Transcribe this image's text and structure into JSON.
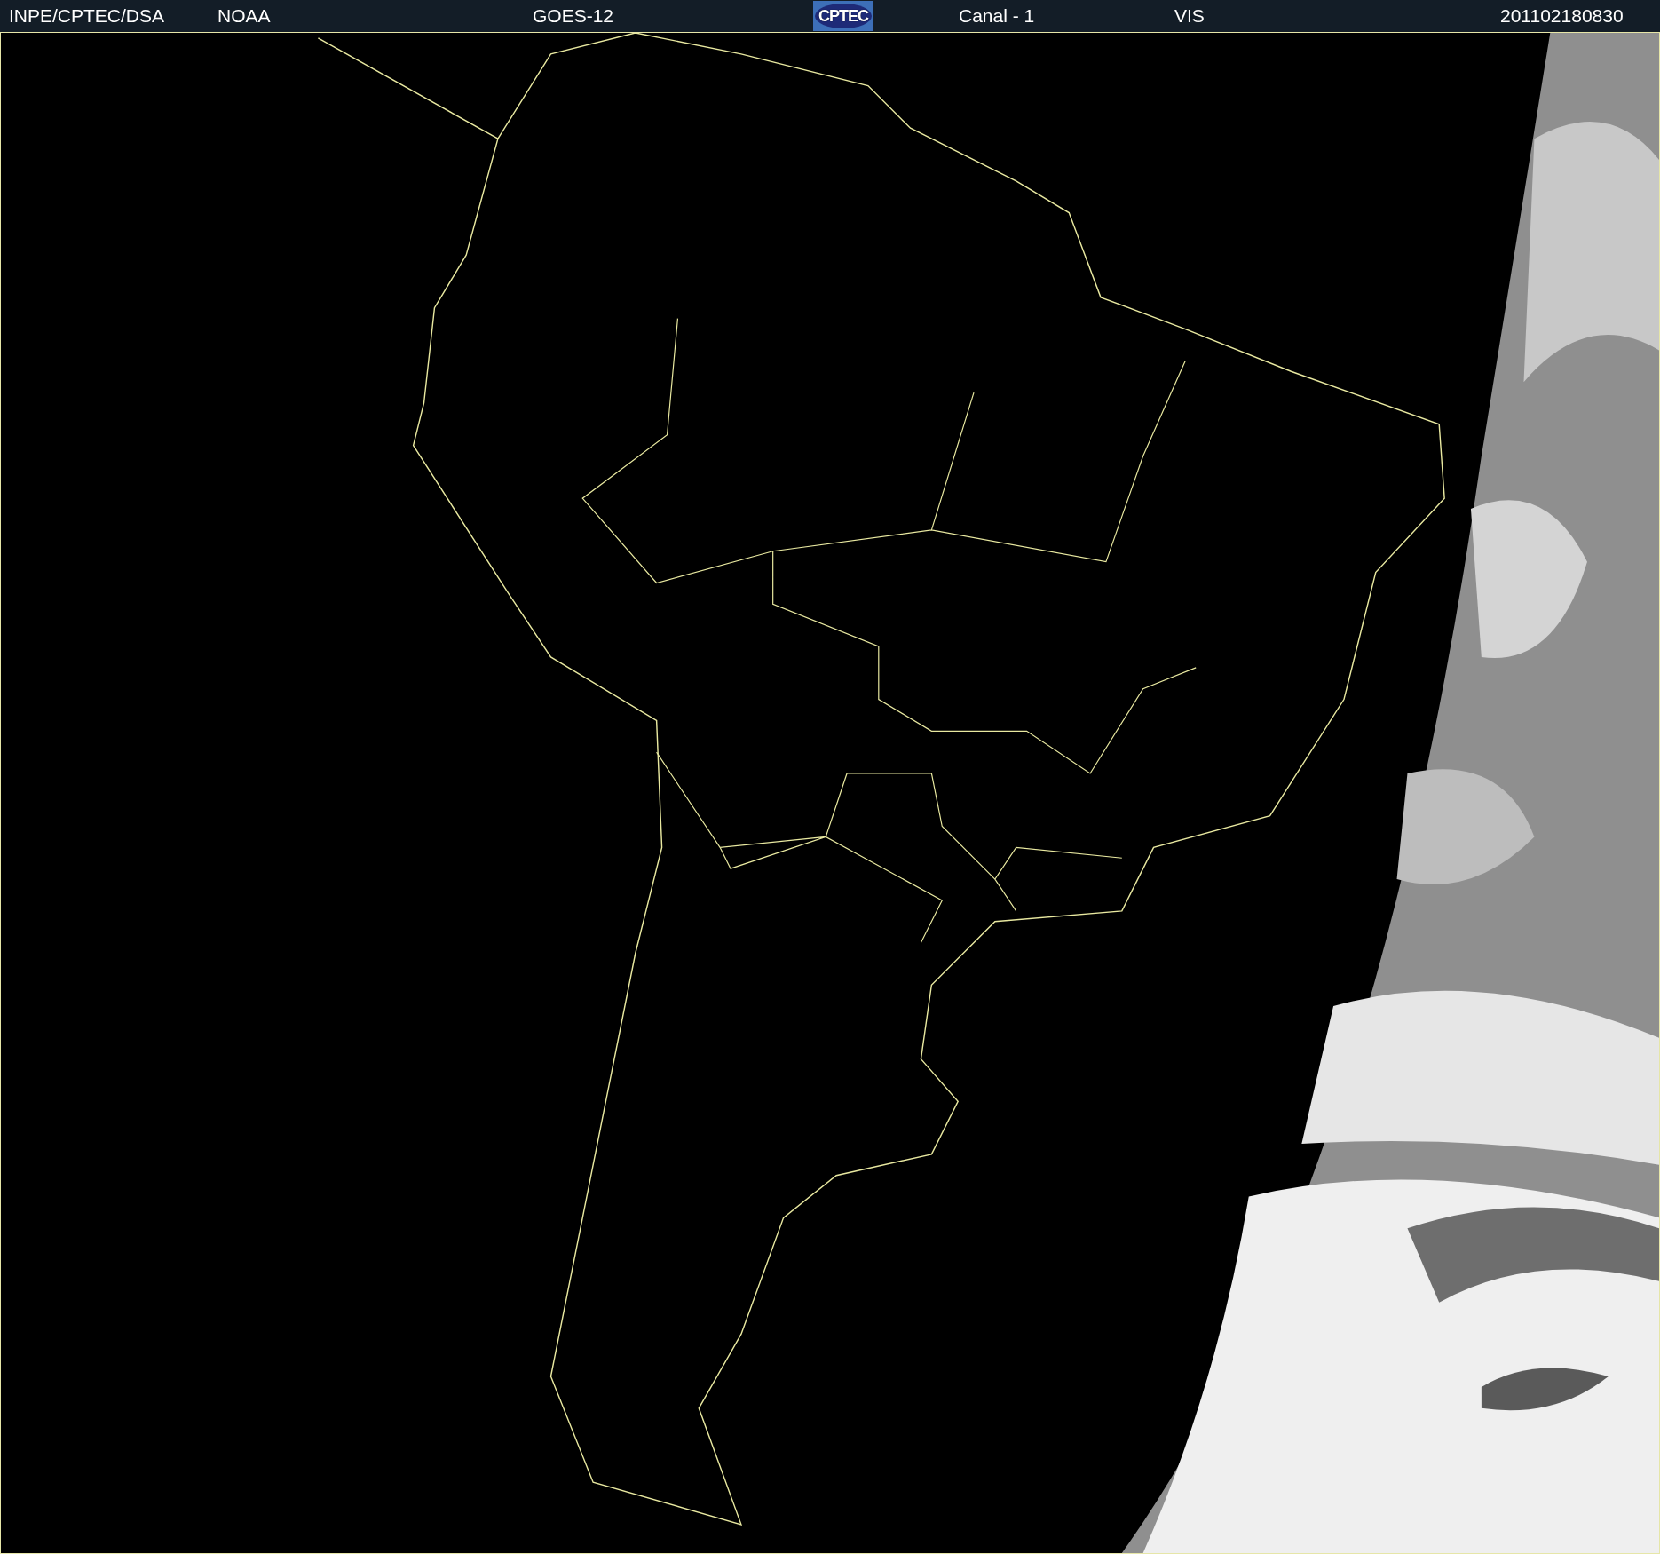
{
  "header": {
    "items": [
      {
        "kind": "text",
        "label": "INPE/CPTEC/DSA"
      },
      {
        "kind": "text",
        "label": "NOAA"
      },
      {
        "kind": "text",
        "label": "GOES-12"
      },
      {
        "kind": "logo",
        "label": "CPTEC"
      },
      {
        "kind": "text",
        "label": "Canal - 1"
      },
      {
        "kind": "text",
        "label": "VIS"
      },
      {
        "kind": "text",
        "label": "201102180830"
      }
    ]
  }
}
